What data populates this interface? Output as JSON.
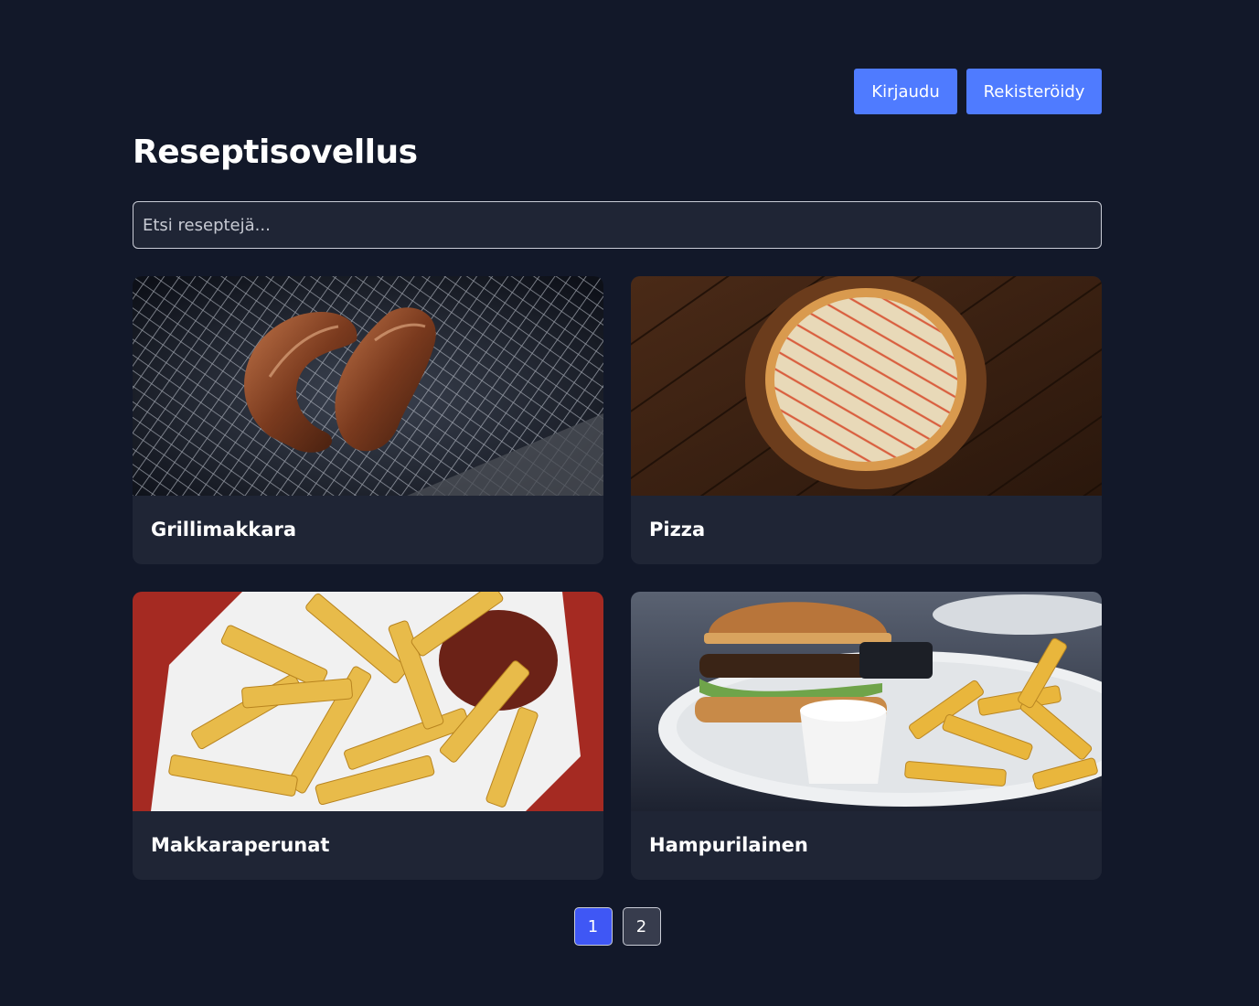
{
  "header": {
    "login_label": "Kirjaudu",
    "register_label": "Rekisteröidy",
    "title": "Reseptisovellus"
  },
  "search": {
    "placeholder": "Etsi reseptejä...",
    "value": ""
  },
  "recipes": [
    {
      "title": "Grillimakkara",
      "image": "grilled-sausage-photo"
    },
    {
      "title": "Pizza",
      "image": "pizza-photo"
    },
    {
      "title": "Makkaraperunat",
      "image": "fries-with-sausage-photo"
    },
    {
      "title": "Hampurilainen",
      "image": "hamburger-photo"
    }
  ],
  "pagination": {
    "pages": [
      "1",
      "2"
    ],
    "current": "1"
  },
  "colors": {
    "background": "#121829",
    "card": "#1f2535",
    "accent": "#4f7bff",
    "active_page": "#3f57f5",
    "inactive_page": "#373c4d"
  }
}
